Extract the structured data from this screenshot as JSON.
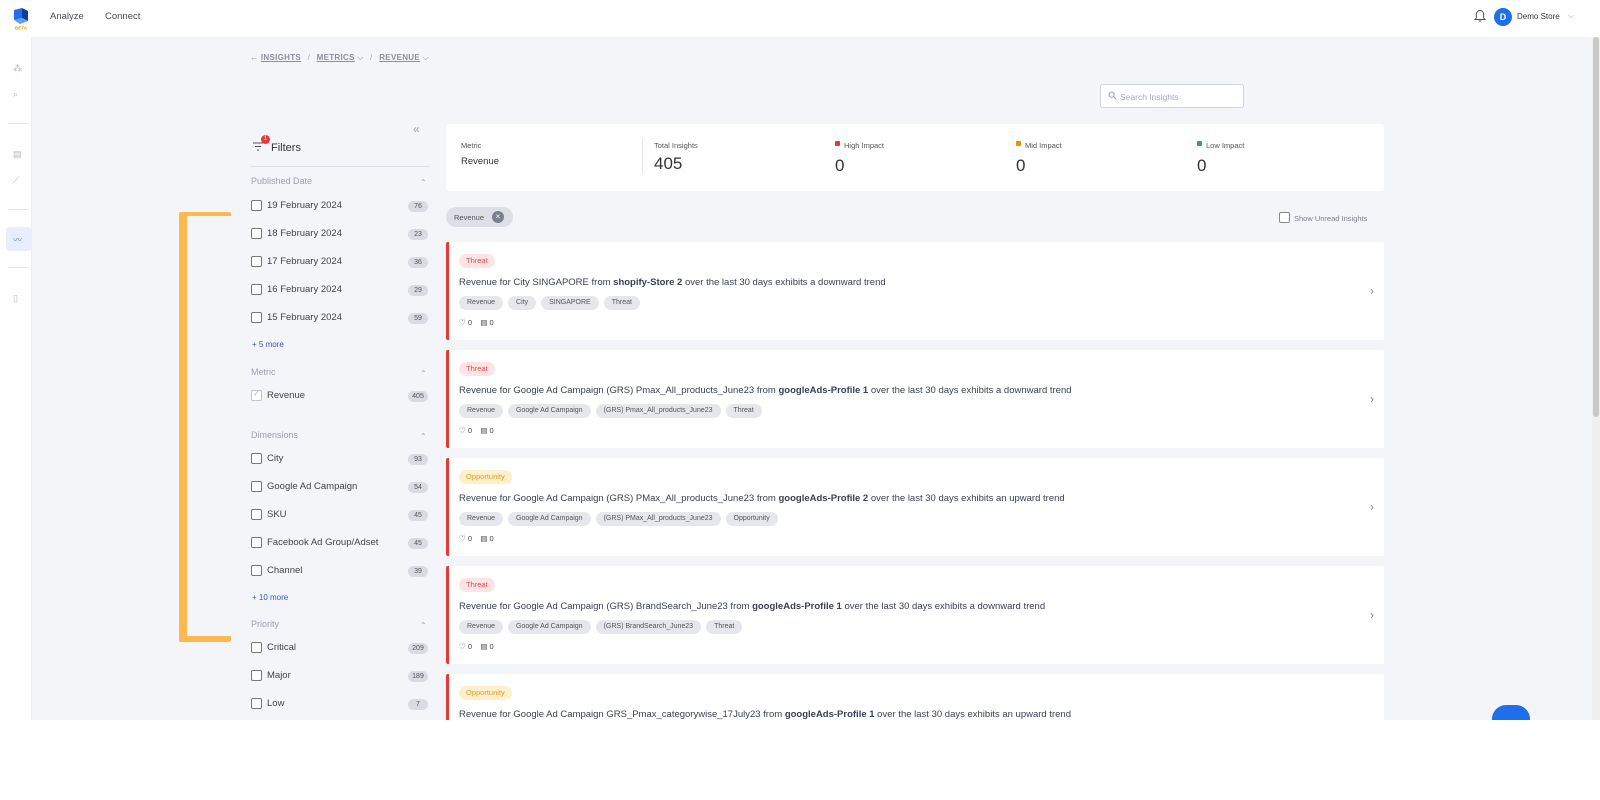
{
  "topbar": {
    "nav": [
      "Analyze",
      "Connect"
    ],
    "store_avatar_letter": "D",
    "store_name": "Demo Store"
  },
  "breadcrumb": {
    "items": [
      "INSIGHTS",
      "METRICS",
      "REVENUE"
    ]
  },
  "search": {
    "placeholder": "Search Insights"
  },
  "filters": {
    "title": "Filters",
    "badge": "1",
    "published_date": {
      "title": "Published Date",
      "options": [
        {
          "label": "19 February 2024",
          "count": "76"
        },
        {
          "label": "18 February 2024",
          "count": "23"
        },
        {
          "label": "17 February 2024",
          "count": "36"
        },
        {
          "label": "16 February 2024",
          "count": "29"
        },
        {
          "label": "15 February 2024",
          "count": "59"
        }
      ],
      "more": "+ 5 more"
    },
    "metric": {
      "title": "Metric",
      "options": [
        {
          "label": "Revenue",
          "count": "405",
          "checked": true
        }
      ]
    },
    "dimensions": {
      "title": "Dimensions",
      "options": [
        {
          "label": "City",
          "count": "93"
        },
        {
          "label": "Google Ad Campaign",
          "count": "54"
        },
        {
          "label": "SKU",
          "count": "45"
        },
        {
          "label": "Facebook Ad Group/Adset",
          "count": "45"
        },
        {
          "label": "Channel",
          "count": "39"
        }
      ],
      "more": "+ 10 more"
    },
    "priority": {
      "title": "Priority",
      "options": [
        {
          "label": "Critical",
          "count": "209"
        },
        {
          "label": "Major",
          "count": "189"
        },
        {
          "label": "Low",
          "count": "7"
        }
      ]
    }
  },
  "stats": {
    "metric_label": "Metric",
    "metric_value": "Revenue",
    "total_label": "Total Insights",
    "total_value": "405",
    "high_label": "High Impact",
    "high_value": "0",
    "mid_label": "Mid Impact",
    "mid_value": "0",
    "low_label": "Low Impact",
    "low_value": "0",
    "colors": {
      "high": "#e53935",
      "mid": "#f28c1a",
      "low": "#2ea84a"
    }
  },
  "active_filter_chip": "Revenue",
  "show_unread_label": "Show Unread Insights",
  "insights": [
    {
      "badge": "Threat",
      "title_pre": "Revenue for City SINGAPORE from ",
      "title_bold": "shopify-Store 2",
      "title_post": " over the last 30 days exhibits a downward trend",
      "tags": [
        "Revenue",
        "City",
        "SINGAPORE",
        "Threat"
      ],
      "likes": "0",
      "comments": "0"
    },
    {
      "badge": "Threat",
      "title_pre": "Revenue for Google Ad Campaign (GRS) Pmax_All_products_June23 from ",
      "title_bold": "googleAds-Profile 1",
      "title_post": " over the last 30 days exhibits a downward trend",
      "tags": [
        "Revenue",
        "Google Ad Campaign",
        "(GRS) Pmax_All_products_June23",
        "Threat"
      ],
      "likes": "0",
      "comments": "0"
    },
    {
      "badge": "Opportunity",
      "title_pre": "Revenue for Google Ad Campaign (GRS) PMax_All_products_June23 from ",
      "title_bold": "googleAds-Profile 2",
      "title_post": " over the last 30 days exhibits an upward trend",
      "tags": [
        "Revenue",
        "Google Ad Campaign",
        "(GRS) PMax_All_products_June23",
        "Opportunity"
      ],
      "likes": "0",
      "comments": "0"
    },
    {
      "badge": "Threat",
      "title_pre": "Revenue for Google Ad Campaign (GRS) BrandSearch_June23 from ",
      "title_bold": "googleAds-Profile 1",
      "title_post": " over the last 30 days exhibits a downward trend",
      "tags": [
        "Revenue",
        "Google Ad Campaign",
        "(GRS) BrandSearch_June23",
        "Threat"
      ],
      "likes": "0",
      "comments": "0"
    },
    {
      "badge": "Opportunity",
      "title_pre": "Revenue for Google Ad Campaign GRS_Pmax_categorywise_17July23 from ",
      "title_bold": "googleAds-Profile 1",
      "title_post": " over the last 30 days exhibits an upward trend",
      "tags": [],
      "likes": "",
      "comments": ""
    }
  ]
}
